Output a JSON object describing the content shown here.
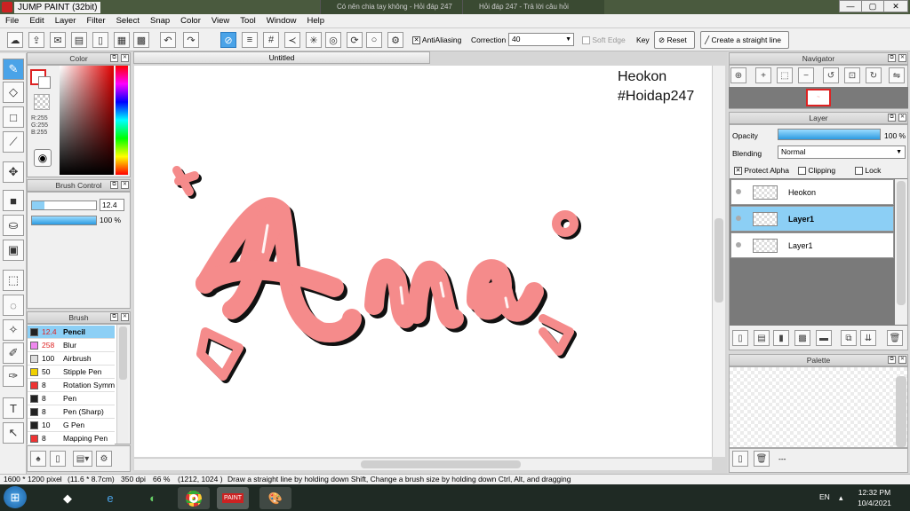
{
  "window": {
    "title": "JUMP PAINT (32bit)",
    "bg_tabs": [
      "Có nên chia tay không - Hỏi đáp 247",
      "Hỏi đáp 247 - Trả lời câu hỏi"
    ],
    "controls": [
      "—",
      "▢",
      "✕"
    ]
  },
  "menu": [
    "File",
    "Edit",
    "Layer",
    "Filter",
    "Select",
    "Snap",
    "Color",
    "View",
    "Tool",
    "Window",
    "Help"
  ],
  "toolbar": {
    "antialiasing": "AntiAliasing",
    "correction_label": "Correction",
    "correction_value": "40",
    "soft_edge": "Soft Edge",
    "key_label": "Key",
    "reset": "Reset",
    "straight_line": "Create a straight line"
  },
  "color_panel": {
    "title": "Color",
    "r": "R:255",
    "g": "G:255",
    "b": "B:255"
  },
  "brush_control": {
    "title": "Brush Control",
    "size": "12.4",
    "opacity": "100 %",
    "opacity_level": 100
  },
  "brush_panel": {
    "title": "Brush",
    "items": [
      {
        "size": "12.4",
        "name": "Pencil",
        "color": "#222222",
        "selected": true
      },
      {
        "size": "258",
        "name": "Blur",
        "color": "#ee88ee",
        "selected": false
      },
      {
        "size": "100",
        "name": "Airbrush",
        "color": "#dddddd",
        "selected": false
      },
      {
        "size": "50",
        "name": "Stipple Pen",
        "color": "#f0d000",
        "selected": false
      },
      {
        "size": "8",
        "name": "Rotation Symm",
        "color": "#ee3333",
        "selected": false
      },
      {
        "size": "8",
        "name": "Pen",
        "color": "#222222",
        "selected": false
      },
      {
        "size": "8",
        "name": "Pen (Sharp)",
        "color": "#222222",
        "selected": false
      },
      {
        "size": "10",
        "name": "G Pen",
        "color": "#222222",
        "selected": false
      },
      {
        "size": "8",
        "name": "Mapping Pen",
        "color": "#ee3333",
        "selected": false
      }
    ]
  },
  "document": {
    "tab": "Untitled",
    "text_line1": "Heokon",
    "text_line2": "#Hoidap247",
    "art_color": "#f58b8b"
  },
  "navigator": {
    "title": "Navigator"
  },
  "layer_panel": {
    "title": "Layer",
    "opacity_label": "Opacity",
    "opacity_value": "100 %",
    "opacity_level": 100,
    "blending_label": "Blending",
    "blending_value": "Normal",
    "protect_alpha": "Protect Alpha",
    "clipping": "Clipping",
    "lock": "Lock",
    "layers": [
      {
        "name": "Heokon",
        "selected": false
      },
      {
        "name": "Layer1",
        "selected": true
      },
      {
        "name": "Layer1",
        "selected": false
      }
    ]
  },
  "palette": {
    "title": "Palette",
    "ellipsis": "---"
  },
  "status": {
    "size": "1600 * 1200 pixel",
    "cm": "(11.6 * 8.7cm)",
    "dpi": "350 dpi",
    "zoom": "66 %",
    "coords": "(1212, 1024 )",
    "hint": "Draw a straight line by holding down Shift, Change a brush size by holding down Ctrl, Alt, and dragging"
  },
  "taskbar": {
    "lang": "EN",
    "time": "12:32 PM",
    "date": "10/4/2021"
  }
}
